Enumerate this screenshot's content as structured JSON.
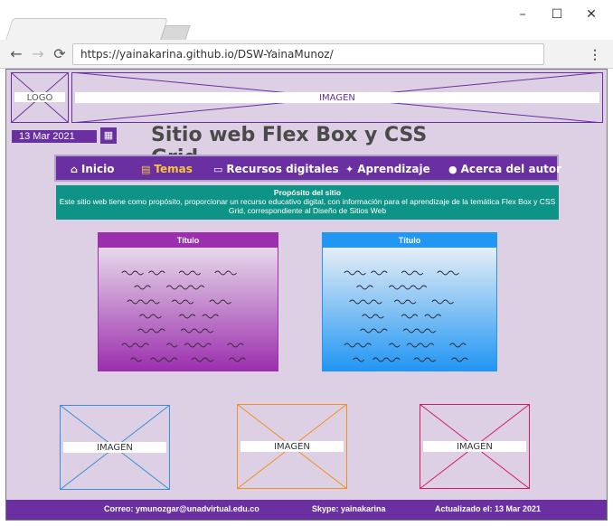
{
  "browser": {
    "url": "https://yainakarina.github.io/DSW-YainaMunoz/",
    "window_controls": {
      "minimize": "–",
      "maximize": "☐",
      "close": "✕"
    },
    "nav_icons": {
      "back": "←",
      "forward": "→",
      "reload": "⟳"
    },
    "menu_icon": "⋮"
  },
  "header": {
    "logo_label": "LOGO",
    "banner_label": "IMAGEN",
    "date": "13 Mar 2021",
    "calendar_icon": "▦",
    "title": "Sitio web Flex Box y CSS Grid"
  },
  "nav": {
    "items": [
      {
        "icon": "⌂",
        "icon_name": "home-icon",
        "label": "Inicio"
      },
      {
        "icon": "▤",
        "icon_name": "book-icon",
        "label": "Temas",
        "active": true
      },
      {
        "icon": "▭",
        "icon_name": "monitor-icon",
        "label": "Recursos digitales"
      },
      {
        "icon": "✦",
        "icon_name": "graduation-cap-icon",
        "label": "Aprendizaje"
      },
      {
        "icon": "●",
        "icon_name": "comment-icon",
        "label": "Acerca del autor"
      }
    ],
    "active_color": "#f5c938"
  },
  "purpose": {
    "title": "Propósito del sitio",
    "text": "Este sitio web tiene como propósito, proporcionar un recurso educativo digital, con información para el aprendizaje de la temática Flex Box y CSS Grid, correspondiente al Diseño de Sitios Web"
  },
  "cards": [
    {
      "title": "Título",
      "color": "#9b2fae"
    },
    {
      "title": "Título",
      "color": "#2196f3"
    }
  ],
  "images": [
    {
      "label": "IMAGEN",
      "color": "#3a8fd8"
    },
    {
      "label": "IMAGEN",
      "color": "#f0901e"
    },
    {
      "label": "IMAGEN",
      "color": "#d81b60"
    }
  ],
  "footer": {
    "email": "Correo: ymunozgar@unadvirtual.edu.co",
    "skype": "Skype: yainakarina",
    "updated": "Actualizado el: 13 Mar 2021"
  },
  "colors": {
    "page_bg": "#ddd0e4",
    "primary": "#6a2fa0",
    "purpose_bg": "#0e9486"
  }
}
